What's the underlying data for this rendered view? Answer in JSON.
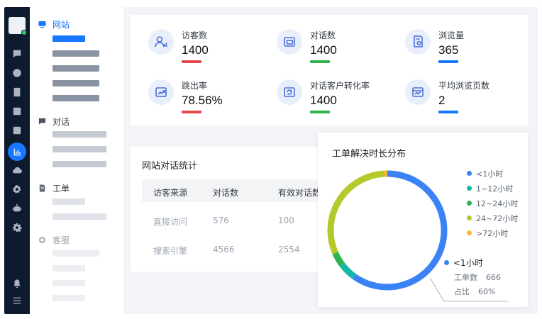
{
  "colors": {
    "accent": "#1677ff",
    "rail_bg": "#0e1b2e",
    "red": "#e5484d",
    "green": "#2fb350",
    "blue": "#1677ff"
  },
  "rail": {
    "icons": [
      "chat-icon",
      "circle-icon",
      "book-icon",
      "square-icon",
      "square-icon",
      "chart-icon",
      "cloud-icon",
      "settings-wheel-icon",
      "robot-icon",
      "gear-icon",
      "bell-icon",
      "menu-icon"
    ]
  },
  "nav": {
    "website_label": "网站",
    "chat_label": "对话",
    "ticket_label": "工单",
    "service_label": "客服"
  },
  "stats": [
    {
      "label": "访客数",
      "value": "1400",
      "bar_color": "#e5484d",
      "icon": "visitor-icon"
    },
    {
      "label": "对话数",
      "value": "1400",
      "bar_color": "#2fb350",
      "icon": "chat-window-icon"
    },
    {
      "label": "浏览量",
      "value": "365",
      "bar_color": "#1677ff",
      "icon": "page-view-icon"
    },
    {
      "label": "跳出率",
      "value": "78.56%",
      "bar_color": "#e5484d",
      "icon": "bounce-icon"
    },
    {
      "label": "对话客户转化率",
      "value": "1400",
      "bar_color": "#2fb350",
      "icon": "conversion-icon"
    },
    {
      "label": "平均浏览页数",
      "value": "2",
      "bar_color": "#1677ff",
      "icon": "avg-pages-icon"
    }
  ],
  "table": {
    "title": "网站对话统计",
    "headers": [
      "访客来源",
      "对话数",
      "有效对话数"
    ],
    "rows": [
      [
        "直接访问",
        "576",
        "100"
      ],
      [
        "搜索引擎",
        "4566",
        "2554"
      ]
    ]
  },
  "chart_data": {
    "type": "pie",
    "title": "工单解决时长分布",
    "categories": [
      "<1小时",
      "1~12小时",
      "12~24小时",
      "24~72小时",
      ">72小时"
    ],
    "values": [
      666,
      52,
      42,
      340,
      10
    ],
    "colors": [
      "#3b82f6",
      "#14b8a6",
      "#2fb350",
      "#b5c92a",
      "#f5b82e"
    ],
    "legend_position": "right",
    "tooltip": {
      "series": "<1小时",
      "count_label": "工单数",
      "count_value": "666",
      "ratio_label": "占比",
      "ratio_value": "60%"
    }
  }
}
